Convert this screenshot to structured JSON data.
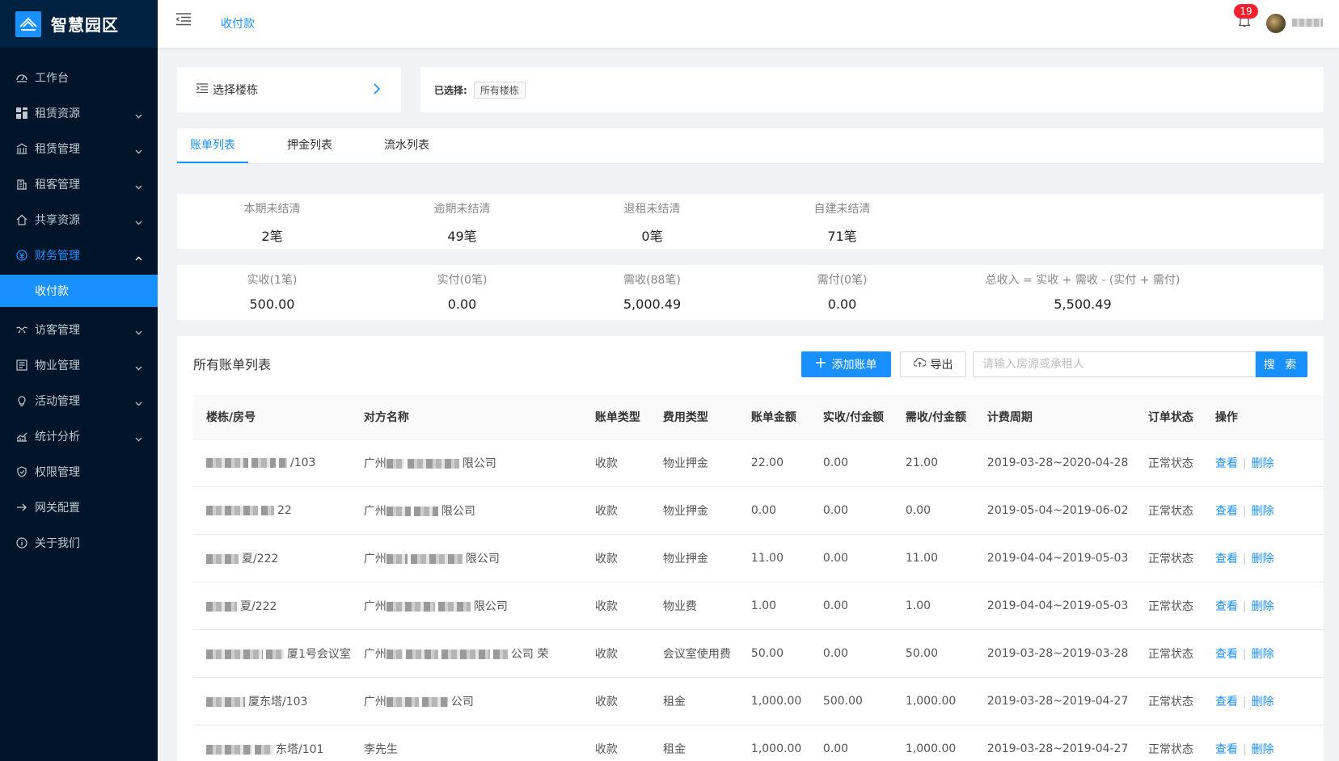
{
  "app": {
    "title": "智慧园区"
  },
  "sidebar": {
    "items": [
      {
        "label": "工作台",
        "icon": "dashboard-icon",
        "expandable": false
      },
      {
        "label": "租赁资源",
        "icon": "grid-icon",
        "expandable": true
      },
      {
        "label": "租赁管理",
        "icon": "bank-icon",
        "expandable": true
      },
      {
        "label": "租客管理",
        "icon": "building-icon",
        "expandable": true
      },
      {
        "label": "共享资源",
        "icon": "home-icon",
        "expandable": true
      },
      {
        "label": "财务管理",
        "icon": "finance-icon",
        "expandable": true,
        "open": true
      },
      {
        "label": "访客管理",
        "icon": "handshake-icon",
        "expandable": true
      },
      {
        "label": "物业管理",
        "icon": "profile-icon",
        "expandable": true
      },
      {
        "label": "活动管理",
        "icon": "bulb-icon",
        "expandable": true
      },
      {
        "label": "统计分析",
        "icon": "stock-icon",
        "expandable": true
      },
      {
        "label": "权限管理",
        "icon": "safety-icon",
        "expandable": false
      },
      {
        "label": "网关配置",
        "icon": "arrow-right-icon",
        "expandable": false
      },
      {
        "label": "关于我们",
        "icon": "info-icon",
        "expandable": false
      }
    ],
    "active_sub": "收付款"
  },
  "header": {
    "breadcrumb": "收付款",
    "notification_count": "19"
  },
  "building_selector": {
    "label": "选择楼栋"
  },
  "selected": {
    "label": "已选择:",
    "tag": "所有楼栋"
  },
  "tabs": [
    "账单列表",
    "押金列表",
    "流水列表"
  ],
  "stats_row1": [
    {
      "label": "本期未结清",
      "value": "2笔"
    },
    {
      "label": "逾期未结清",
      "value": "49笔"
    },
    {
      "label": "退租未结清",
      "value": "0笔"
    },
    {
      "label": "自建未结清",
      "value": "71笔"
    }
  ],
  "stats_row2": [
    {
      "label": "实收(1笔)",
      "value": "500.00"
    },
    {
      "label": "实付(0笔)",
      "value": "0.00"
    },
    {
      "label": "需收(88笔)",
      "value": "5,000.49"
    },
    {
      "label": "需付(0笔)",
      "value": "0.00"
    },
    {
      "label": "总收入 = 实收 + 需收 - (实付 + 需付)",
      "value": "5,500.49"
    }
  ],
  "panel": {
    "title": "所有账单列表",
    "add_label": "添加账单",
    "export_label": "导出",
    "search_placeholder": "请输入房源或承租人",
    "search_label": "搜 索"
  },
  "table": {
    "headers": [
      "楼栋/房号",
      "对方名称",
      "账单类型",
      "费用类型",
      "账单金额",
      "实收/付金额",
      "需收/付金额",
      "计费周期",
      "订单状态",
      "操作"
    ],
    "rows": [
      {
        "room": "/103",
        "party_prefix": "广州",
        "party_suffix": "限公司",
        "type": "收款",
        "fee": "物业押金",
        "amount": "22.00",
        "paid": "0.00",
        "due": "21.00",
        "period": "2019-03-28~2020-04-28",
        "status": "正常状态"
      },
      {
        "room": "22",
        "party_prefix": "广州",
        "party_suffix": "限公司",
        "type": "收款",
        "fee": "物业押金",
        "amount": "0.00",
        "paid": "0.00",
        "due": "0.00",
        "period": "2019-05-04~2019-06-02",
        "status": "正常状态"
      },
      {
        "room": "夏/222",
        "party_prefix": "广州",
        "party_suffix": "限公司",
        "type": "收款",
        "fee": "物业押金",
        "amount": "11.00",
        "paid": "0.00",
        "due": "11.00",
        "period": "2019-04-04~2019-05-03",
        "status": "正常状态"
      },
      {
        "room": "夏/222",
        "party_prefix": "广州",
        "party_suffix": "限公司",
        "type": "收款",
        "fee": "物业费",
        "amount": "1.00",
        "paid": "0.00",
        "due": "1.00",
        "period": "2019-04-04~2019-05-03",
        "status": "正常状态"
      },
      {
        "room": "厦1号会议室",
        "party_prefix": "广州",
        "party_suffix": "公司 荣",
        "type": "收款",
        "fee": "会议室使用费",
        "amount": "50.00",
        "paid": "0.00",
        "due": "50.00",
        "period": "2019-03-28~2019-03-28",
        "status": "正常状态"
      },
      {
        "room": "厦东塔/103",
        "party_prefix": "广州",
        "party_suffix": "公司",
        "type": "收款",
        "fee": "租金",
        "amount": "1,000.00",
        "paid": "500.00",
        "due": "1,000.00",
        "period": "2019-03-28~2019-04-27",
        "status": "正常状态"
      },
      {
        "room": "东塔/101",
        "party_prefix": "李先生",
        "party_suffix": "",
        "type": "收款",
        "fee": "租金",
        "amount": "1,000.00",
        "paid": "0.00",
        "due": "1,000.00",
        "period": "2019-03-28~2019-04-27",
        "status": "正常状态"
      }
    ],
    "view_label": "查看",
    "delete_label": "删除"
  },
  "colors": {
    "primary": "#1890ff",
    "sidebar_bg": "#001529",
    "badge": "#f5222d"
  }
}
